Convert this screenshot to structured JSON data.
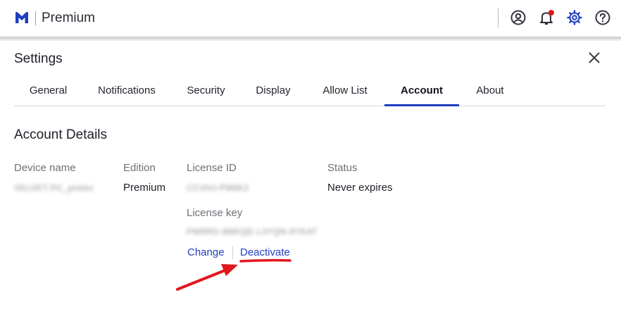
{
  "app": {
    "brand_name": "Premium"
  },
  "settings": {
    "title": "Settings"
  },
  "tabs": [
    {
      "label": "General"
    },
    {
      "label": "Notifications"
    },
    {
      "label": "Security"
    },
    {
      "label": "Display"
    },
    {
      "label": "Allow List"
    },
    {
      "label": "Account",
      "active": true
    },
    {
      "label": "About"
    }
  ],
  "account": {
    "section_title": "Account Details",
    "device_name_label": "Device name",
    "device_name_value": "VELVET-PC_pretex",
    "edition_label": "Edition",
    "edition_value": "Premium",
    "license_id_label": "License ID",
    "license_id_value": "CCVHJ-PM6K2",
    "status_label": "Status",
    "status_value": "Never expires",
    "license_key_label": "License key",
    "license_key_value": "PW6RG-M6KQE-L3YQN-9YKAT",
    "change_link": "Change",
    "deactivate_link": "Deactivate"
  },
  "icons": {
    "logo": "malwarebytes-logo-icon",
    "account": "user-circle-icon",
    "notifications": "bell-icon",
    "settings": "gear-icon",
    "help": "help-circle-icon",
    "close": "close-icon"
  },
  "colors": {
    "accent": "#1f3fbf",
    "notification_dot": "#e1171e",
    "annotation_red": "#e1171e"
  }
}
